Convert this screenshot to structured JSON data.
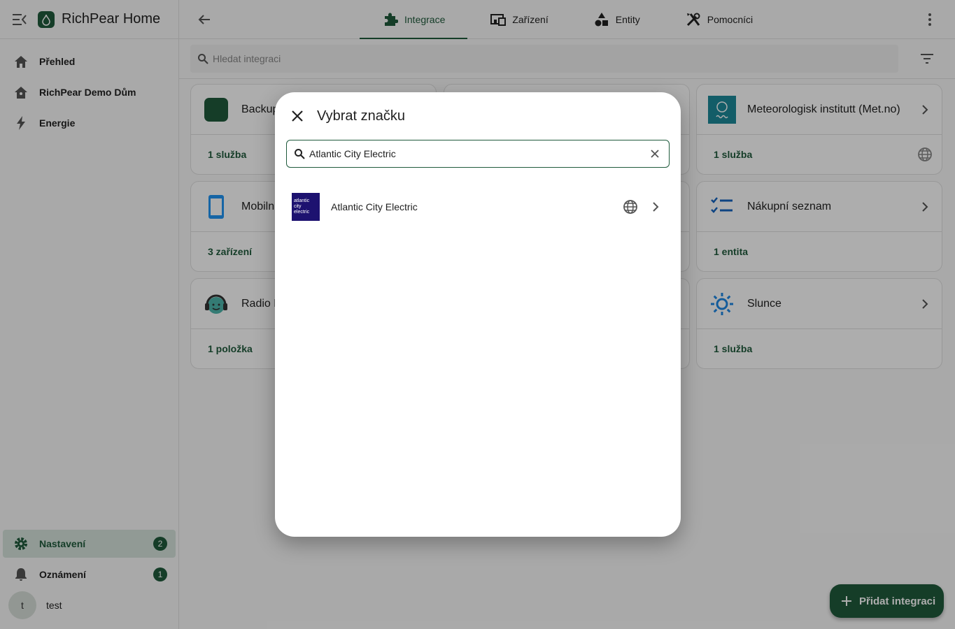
{
  "app": {
    "title": "RichPear Home"
  },
  "sidebar": {
    "items": [
      {
        "label": "Přehled",
        "icon": "home-icon"
      },
      {
        "label": "RichPear Demo Dům",
        "icon": "house-icon"
      },
      {
        "label": "Energie",
        "icon": "lightning-icon"
      }
    ],
    "bottom": [
      {
        "label": "Nastavení",
        "icon": "gear-icon",
        "badge": "2",
        "active": true
      },
      {
        "label": "Oznámení",
        "icon": "bell-icon",
        "badge": "1"
      }
    ],
    "user": {
      "initial": "t",
      "name": "test"
    }
  },
  "tabs": [
    {
      "label": "Integrace",
      "icon": "puzzle-icon",
      "active": true
    },
    {
      "label": "Zařízení",
      "icon": "devices-icon"
    },
    {
      "label": "Entity",
      "icon": "shapes-icon"
    },
    {
      "label": "Pomocníci",
      "icon": "tools-icon"
    }
  ],
  "search": {
    "placeholder": "Hledat integraci"
  },
  "cards": [
    {
      "title": "Backup",
      "footer": "1 služba"
    },
    {
      "title": "Meteorologisk institutt (Met.no)",
      "footer": "1 služba"
    },
    {
      "title": "Mobiln",
      "footer": "3 zařízení"
    },
    {
      "title": "Nákupní seznam",
      "footer": "1 entita"
    },
    {
      "title": "Radio E",
      "footer": "1 položka"
    },
    {
      "title": "Slunce",
      "footer": "1 služba"
    }
  ],
  "fab": {
    "label": "Přidat integraci"
  },
  "dialog": {
    "title": "Vybrat značku",
    "search_value": "Atlantic City Electric",
    "results": [
      {
        "label": "Atlantic City Electric",
        "logo_text": "atlantic city electric"
      }
    ]
  },
  "colors": {
    "primary": "#1f5a3c",
    "brand_logo_bg": "#1d1270"
  }
}
